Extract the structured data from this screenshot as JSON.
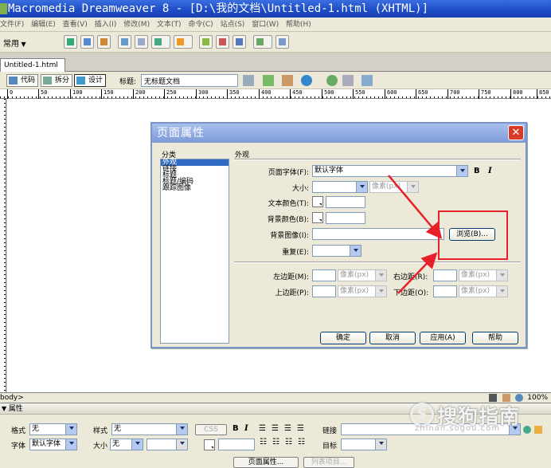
{
  "window": {
    "title": "Macromedia Dreamweaver 8 - [D:\\我的文档\\Untitled-1.html (XHTML)]"
  },
  "menu": [
    "文件(F)",
    "编辑(E)",
    "查看(V)",
    "插入(I)",
    "修改(M)",
    "文本(T)",
    "命令(C)",
    "站点(S)",
    "窗口(W)",
    "帮助(H)"
  ],
  "insert_bar": {
    "category": "常用"
  },
  "document": {
    "tab": "Untitled-1.html",
    "view_buttons": {
      "code": "代码",
      "split": "拆分",
      "design": "设计"
    },
    "title_label": "标题:",
    "title_value": "无标题文档"
  },
  "ruler": {
    "ticks": [
      "0",
      "50",
      "100",
      "150",
      "200",
      "250",
      "300",
      "350",
      "400",
      "450",
      "500",
      "550",
      "600",
      "650",
      "700",
      "750",
      "800",
      "850"
    ]
  },
  "status": {
    "tag": "body>",
    "zoom": "100%"
  },
  "dialog": {
    "title": "页面属性",
    "category_label": "分类",
    "categories": [
      "外观",
      "链接",
      "标题",
      "标题/编码",
      "跟踪图像"
    ],
    "selected_category": "外观",
    "section_label": "外观",
    "fields": {
      "page_font_label": "页面字体(F):",
      "page_font_value": "默认字体",
      "bold": "B",
      "italic": "I",
      "size_label": "大小:",
      "size_value": "",
      "size_unit": "像素(px)",
      "text_color_label": "文本颜色(T):",
      "bg_color_label": "背景颜色(B):",
      "bg_image_label": "背景图像(I):",
      "bg_image_value": "",
      "browse_button": "浏览(B)...",
      "repeat_label": "重复(E):",
      "repeat_value": "",
      "left_margin_label": "左边距(M):",
      "right_margin_label": "右边距(R):",
      "top_margin_label": "上边距(P):",
      "bottom_margin_label": "下边距(O):",
      "margin_unit": "像素(px)"
    },
    "buttons": {
      "ok": "确定",
      "cancel": "取消",
      "apply": "应用(A)",
      "help": "帮助"
    }
  },
  "properties": {
    "header": "属性",
    "format_label": "格式",
    "format_value": "无",
    "style_label": "样式",
    "style_value": "无",
    "css_button": "CSS",
    "link_label": "链接",
    "font_label": "字体",
    "font_value": "默认字体",
    "size_label": "大小",
    "size_value": "无",
    "target_label": "目标",
    "page_props_button": "页面属性...",
    "list_item_button": "列表项目..."
  },
  "watermark": {
    "text": "搜狗指南",
    "url": "zhinan.sogou.com"
  },
  "colors": {
    "titlebar": "#1d4bc4",
    "highlight": "#e8202a",
    "selection": "#316ac5"
  }
}
